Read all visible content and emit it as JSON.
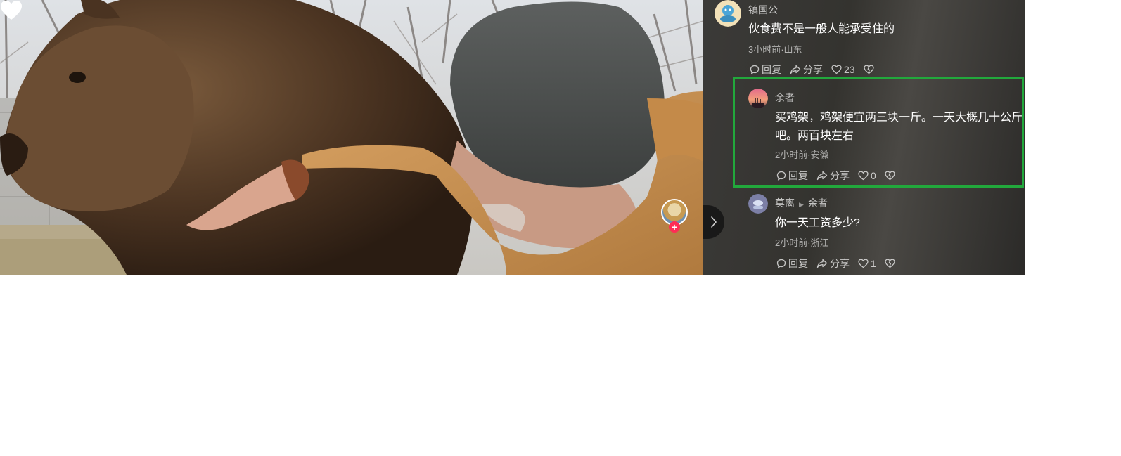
{
  "comments": [
    {
      "user": "镇国公",
      "text": "伙食费不是一般人能承受住的",
      "meta": "3小时前·山东",
      "actions": {
        "reply": "回复",
        "share": "分享",
        "likes": "23"
      }
    },
    {
      "user": "余者",
      "text": "买鸡架，鸡架便宜两三块一斤。一天大概几十公斤吧。两百块左右",
      "meta": "2小时前·安徽",
      "actions": {
        "reply": "回复",
        "share": "分享",
        "likes": "0"
      },
      "highlighted": true
    },
    {
      "user": "莫离",
      "reply_to": "余者",
      "text": "你一天工资多少?",
      "meta": "2小时前·浙江",
      "actions": {
        "reply": "回复",
        "share": "分享",
        "likes": "1"
      }
    }
  ],
  "video": {
    "follow_symbol": "+",
    "icons": [
      "creator-avatar",
      "like-heart-icon"
    ]
  },
  "colors": {
    "highlight_border": "#22a83c",
    "follow_badge": "#fe2c55",
    "panel_bg": "#3b3a38"
  }
}
